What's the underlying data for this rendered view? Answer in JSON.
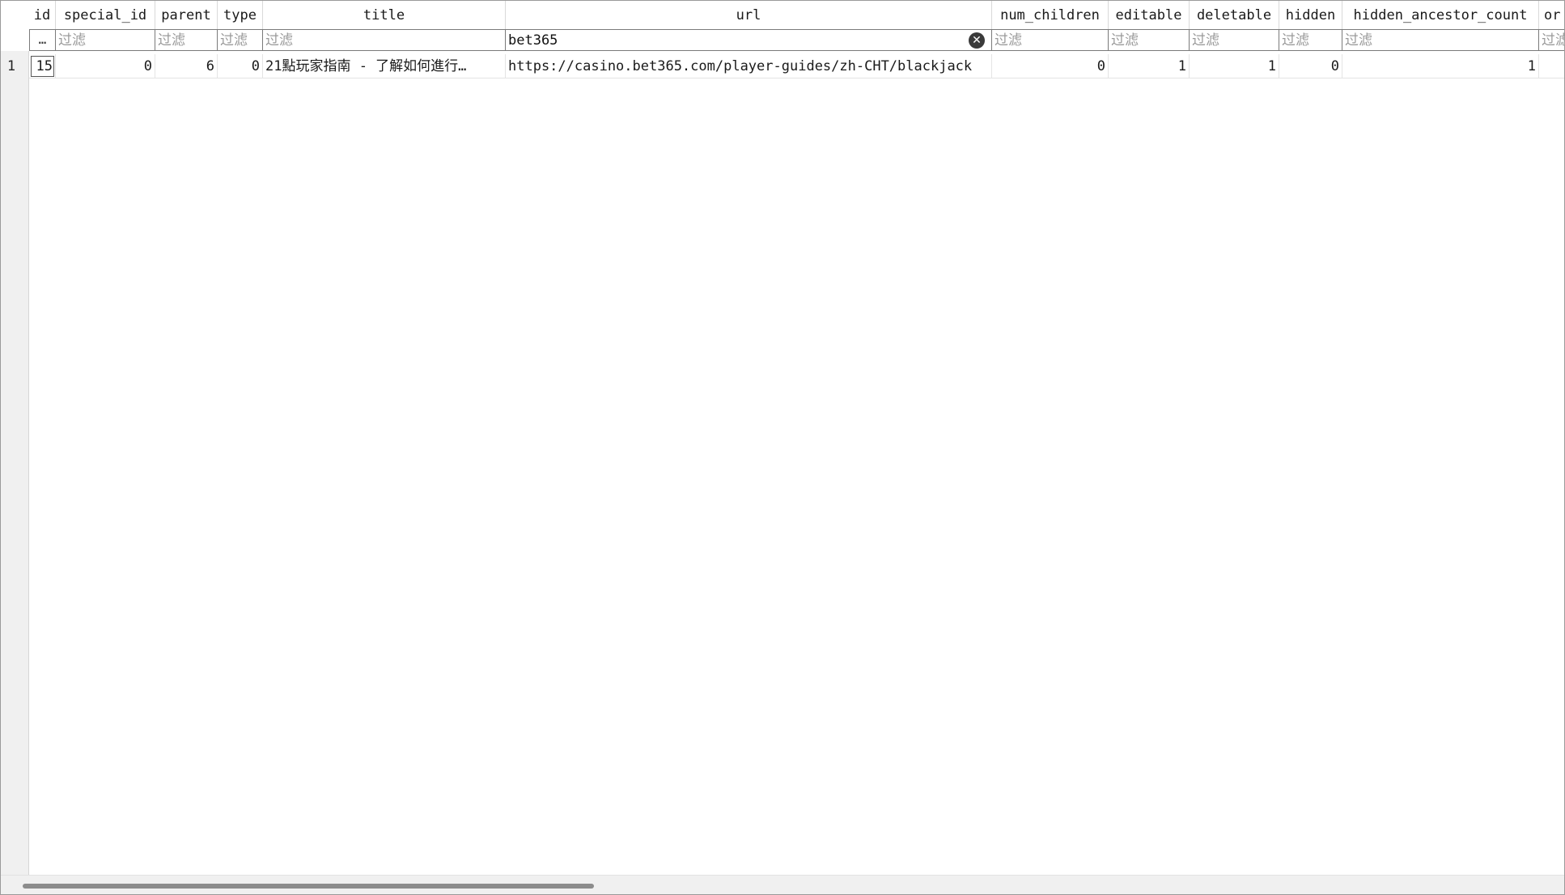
{
  "columns": {
    "id": "id",
    "special_id": "special_id",
    "parent": "parent",
    "type": "type",
    "title": "title",
    "url": "url",
    "num_children": "num_children",
    "editable": "editable",
    "deletable": "deletable",
    "hidden": "hidden",
    "hidden_ancestor_count": "hidden_ancestor_count",
    "or_partial": "or"
  },
  "filters": {
    "more": "…",
    "placeholder": "过滤",
    "url_value": "bet365",
    "clear_icon": "✕"
  },
  "rows": [
    {
      "rownum": "1",
      "id": "15",
      "special_id": "0",
      "parent": "6",
      "type": "0",
      "title": "21點玩家指南 - 了解如何進行…",
      "url": "https://casino.bet365.com/player-guides/zh-CHT/blackjack",
      "num_children": "0",
      "editable": "1",
      "deletable": "1",
      "hidden": "0",
      "hidden_ancestor_count": "1"
    }
  ]
}
